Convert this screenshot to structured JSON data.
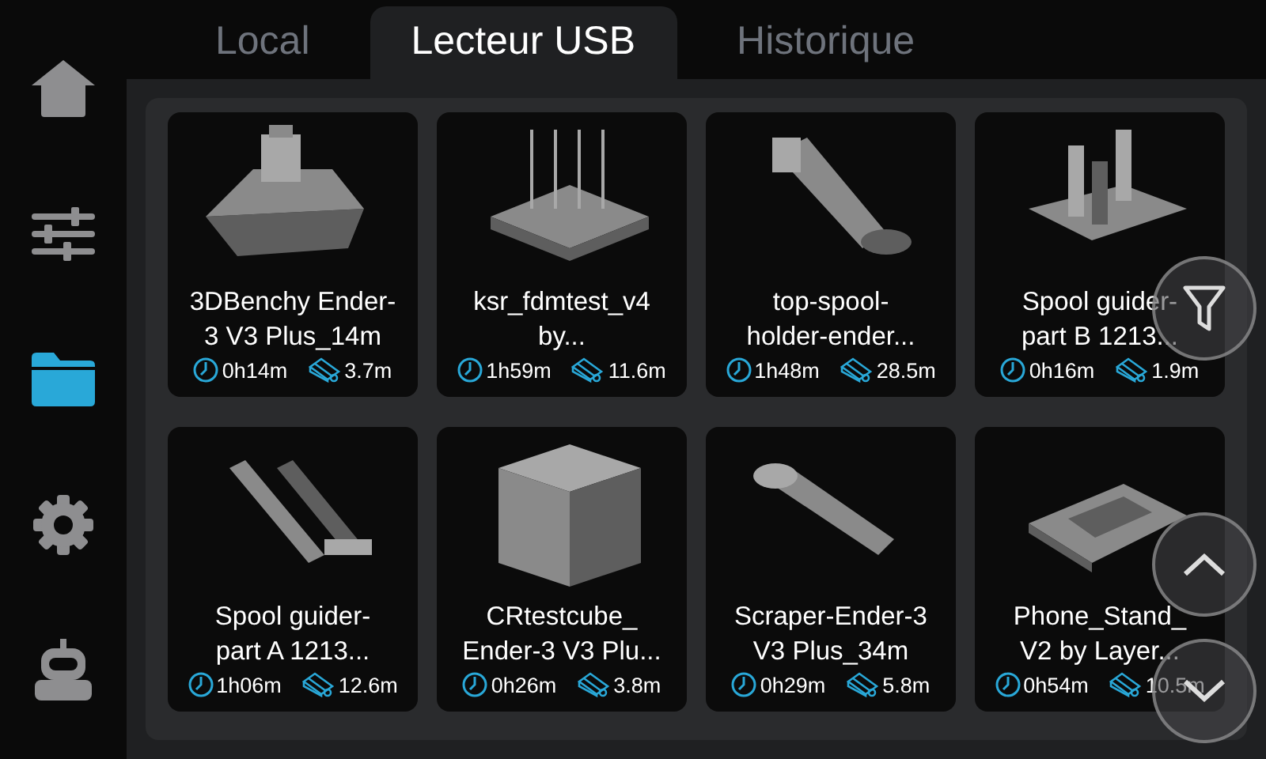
{
  "sidebar": {
    "items": [
      {
        "selected": false
      },
      {
        "selected": false
      },
      {
        "selected": true
      },
      {
        "selected": false
      },
      {
        "selected": false
      }
    ]
  },
  "tabs": [
    {
      "label": "Local",
      "selected": false
    },
    {
      "label": "Lecteur USB",
      "selected": true
    },
    {
      "label": "Historique",
      "selected": false
    }
  ],
  "files": [
    {
      "title_lines": [
        "3DBenchy Ender-",
        "3 V3 Plus_14m"
      ],
      "time": "0h14m",
      "filament": "3.7m"
    },
    {
      "title_lines": [
        "ksr_fdmtest_v4",
        "by..."
      ],
      "time": "1h59m",
      "filament": "11.6m"
    },
    {
      "title_lines": [
        "top-spool-",
        "holder-ender..."
      ],
      "time": "1h48m",
      "filament": "28.5m"
    },
    {
      "title_lines": [
        "Spool guider-",
        "part B 1213..."
      ],
      "time": "0h16m",
      "filament": "1.9m"
    },
    {
      "title_lines": [
        "Spool guider-",
        "part A 1213..."
      ],
      "time": "1h06m",
      "filament": "12.6m"
    },
    {
      "title_lines": [
        "CRtestcube_",
        "Ender-3 V3 Plu..."
      ],
      "time": "0h26m",
      "filament": "3.8m"
    },
    {
      "title_lines": [
        "Scraper-Ender-3",
        "V3 Plus_34m"
      ],
      "time": "0h29m",
      "filament": "5.8m"
    },
    {
      "title_lines": [
        "Phone_Stand_",
        "V2 by Layer..."
      ],
      "time": "0h54m",
      "filament": "10.5m"
    }
  ]
}
